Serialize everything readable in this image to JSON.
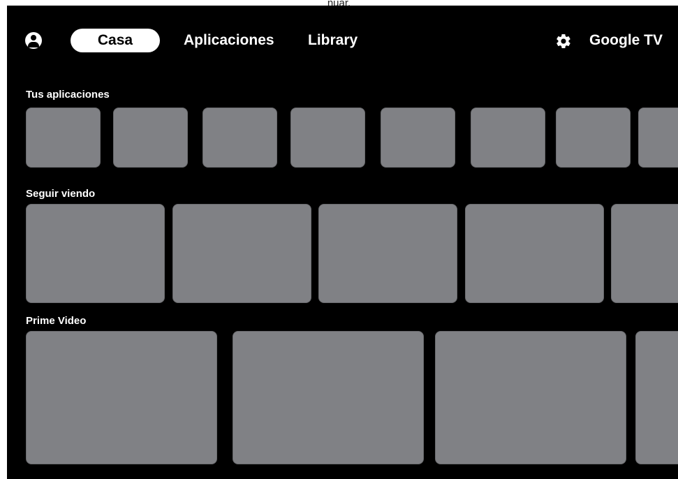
{
  "caption": {
    "text": "nuar."
  },
  "nav": {
    "tabs": [
      {
        "label": "Casa",
        "selected": true
      },
      {
        "label": "Aplicaciones"
      },
      {
        "label": "Library"
      }
    ],
    "profile_icon": "person-icon",
    "settings_icon": "gear-icon",
    "brand": "Google TV"
  },
  "sections": [
    {
      "title": "Tus aplicaciones",
      "tile_count": 8
    },
    {
      "title": "Seguir viendo",
      "tile_count": 5
    },
    {
      "title": "Prime Video",
      "tile_count": 4
    }
  ],
  "colors": {
    "background": "#000000",
    "tile": "#808185",
    "text": "#ffffff",
    "selected_tab_bg": "#ffffff"
  }
}
